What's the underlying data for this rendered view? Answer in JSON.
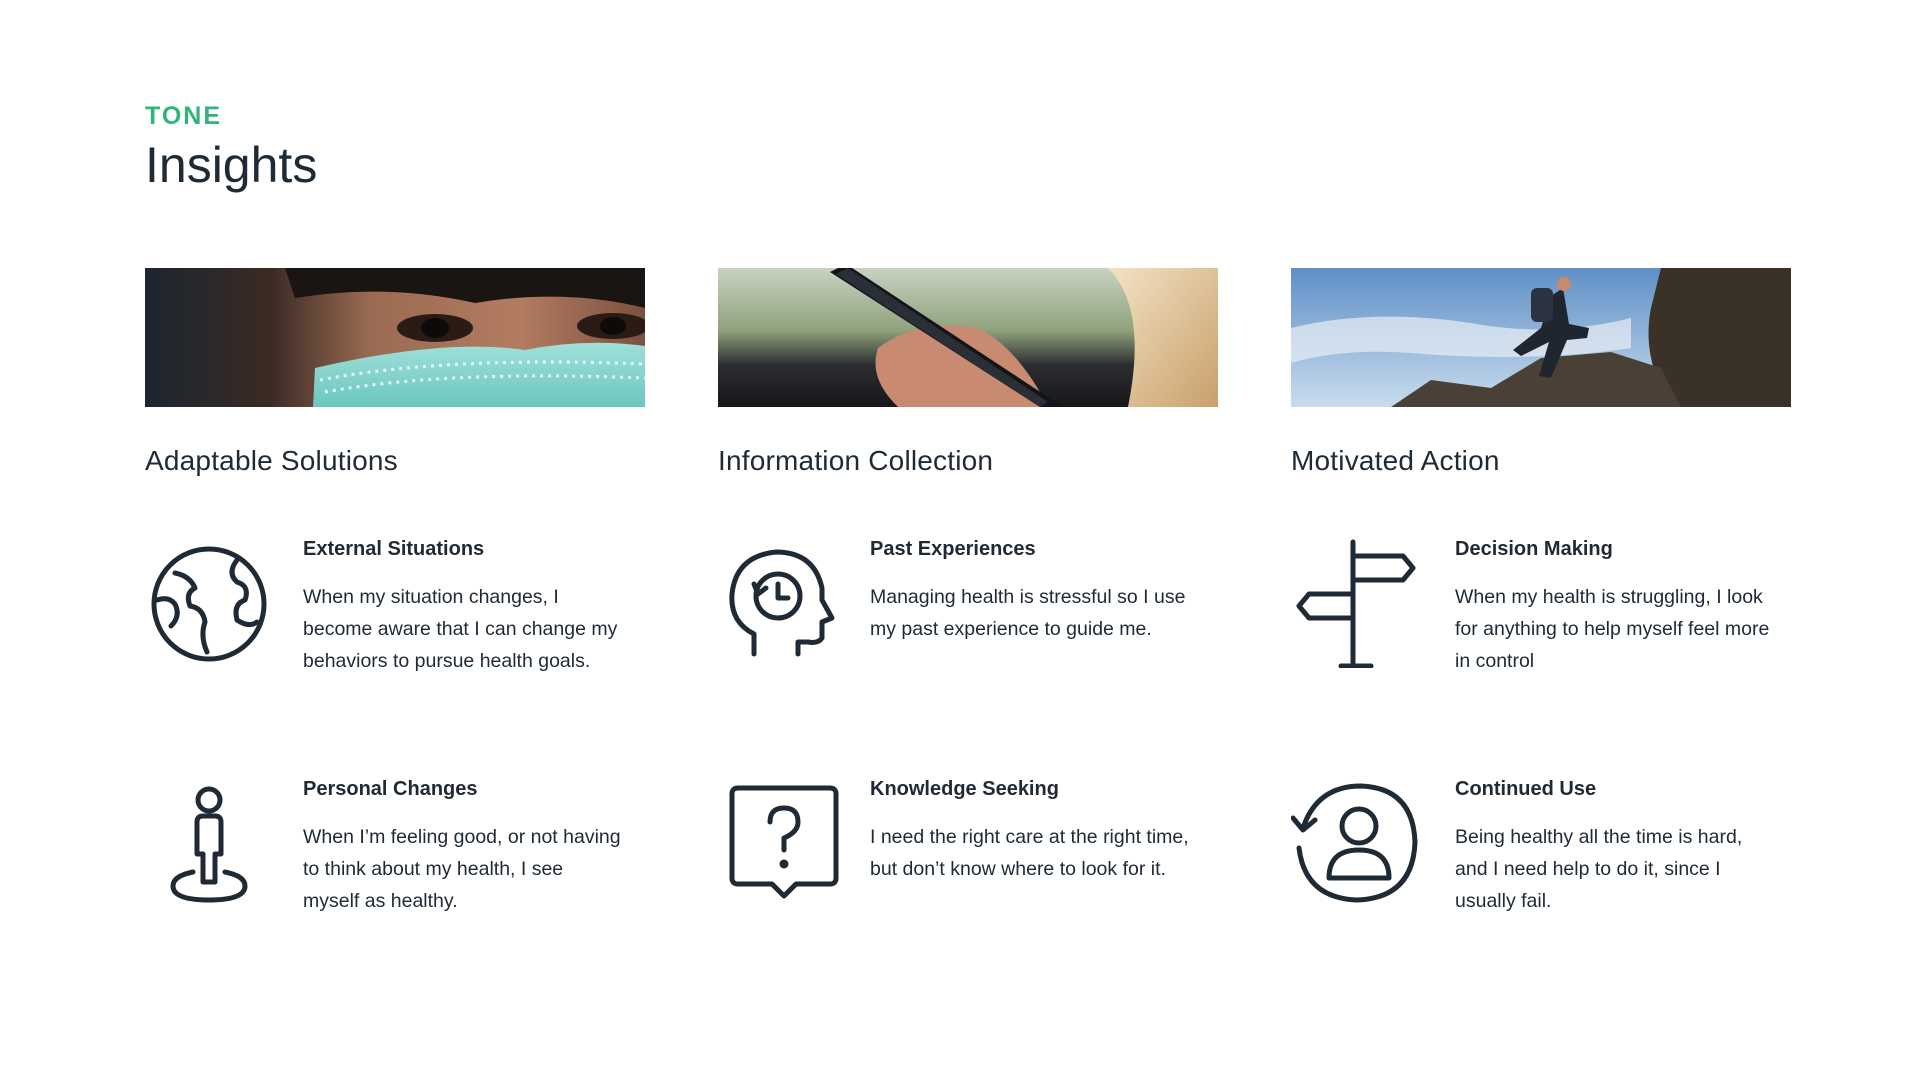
{
  "header": {
    "eyebrow": "TONE",
    "title": "Insights"
  },
  "columns": [
    {
      "title": "Adaptable Solutions",
      "image": "person-wearing-face-mask-photo",
      "items": [
        {
          "icon": "globe-icon",
          "heading": "External Situations",
          "body": "When my situation changes, I become aware that I can change my behaviors to pursue health goals."
        },
        {
          "icon": "person-location-pin-icon",
          "heading": "Personal Changes",
          "body": "When I’m feeling good, or not having to think about my health, I see myself as healthy."
        }
      ]
    },
    {
      "title": "Information Collection",
      "image": "hand-holding-phone-photo",
      "items": [
        {
          "icon": "head-history-icon",
          "heading": "Past Experiences",
          "body": "Managing health is stressful so I use my past experience to guide me."
        },
        {
          "icon": "question-bubble-icon",
          "heading": "Knowledge Seeking",
          "body": "I need the right care at the right time, but don’t know where to look for it."
        }
      ]
    },
    {
      "title": "Motivated Action",
      "image": "hiker-climbing-rocks-photo",
      "items": [
        {
          "icon": "signpost-icon",
          "heading": "Decision Making",
          "body": "When my health is struggling, I look for anything to help myself feel more in control"
        },
        {
          "icon": "user-refresh-icon",
          "heading": "Continued Use",
          "body": "Being healthy all the time is hard, and I need help to do it, since I usually fail."
        }
      ]
    }
  ],
  "colors": {
    "accent": "#2fb57a",
    "text": "#1e2a35",
    "background": "#ffffff"
  }
}
